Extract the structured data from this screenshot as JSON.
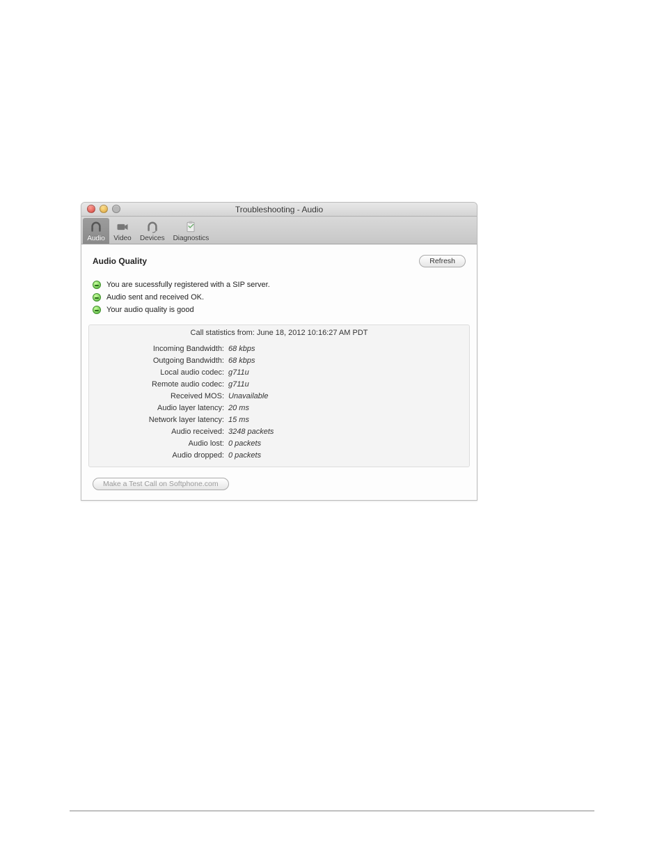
{
  "window": {
    "title": "Troubleshooting - Audio"
  },
  "toolbar": {
    "tabs": [
      {
        "label": "Audio",
        "active": true
      },
      {
        "label": "Video",
        "active": false
      },
      {
        "label": "Devices",
        "active": false
      },
      {
        "label": "Diagnostics",
        "active": false
      }
    ]
  },
  "section": {
    "title": "Audio Quality",
    "refresh_label": "Refresh"
  },
  "status": [
    "You are sucessfully registered with a SIP server.",
    "Audio sent and received OK.",
    "Your audio quality is good"
  ],
  "stats": {
    "heading_prefix": "Call statistics from: ",
    "timestamp": "June 18, 2012 10:16:27 AM PDT",
    "rows": [
      {
        "label": "Incoming Bandwidth:",
        "value": "68 kbps"
      },
      {
        "label": "Outgoing Bandwidth:",
        "value": "68 kbps"
      },
      {
        "label": "Local audio codec:",
        "value": "g711u"
      },
      {
        "label": "Remote audio codec:",
        "value": "g711u"
      },
      {
        "label": "Received MOS:",
        "value": "Unavailable"
      },
      {
        "label": "Audio layer latency:",
        "value": "20 ms"
      },
      {
        "label": "Network layer latency:",
        "value": "15 ms"
      },
      {
        "label": "Audio received:",
        "value": "3248 packets"
      },
      {
        "label": "Audio lost:",
        "value": "0 packets"
      },
      {
        "label": "Audio dropped:",
        "value": "0 packets"
      }
    ]
  },
  "footer": {
    "test_call_label": "Make a Test Call on Softphone.com"
  }
}
